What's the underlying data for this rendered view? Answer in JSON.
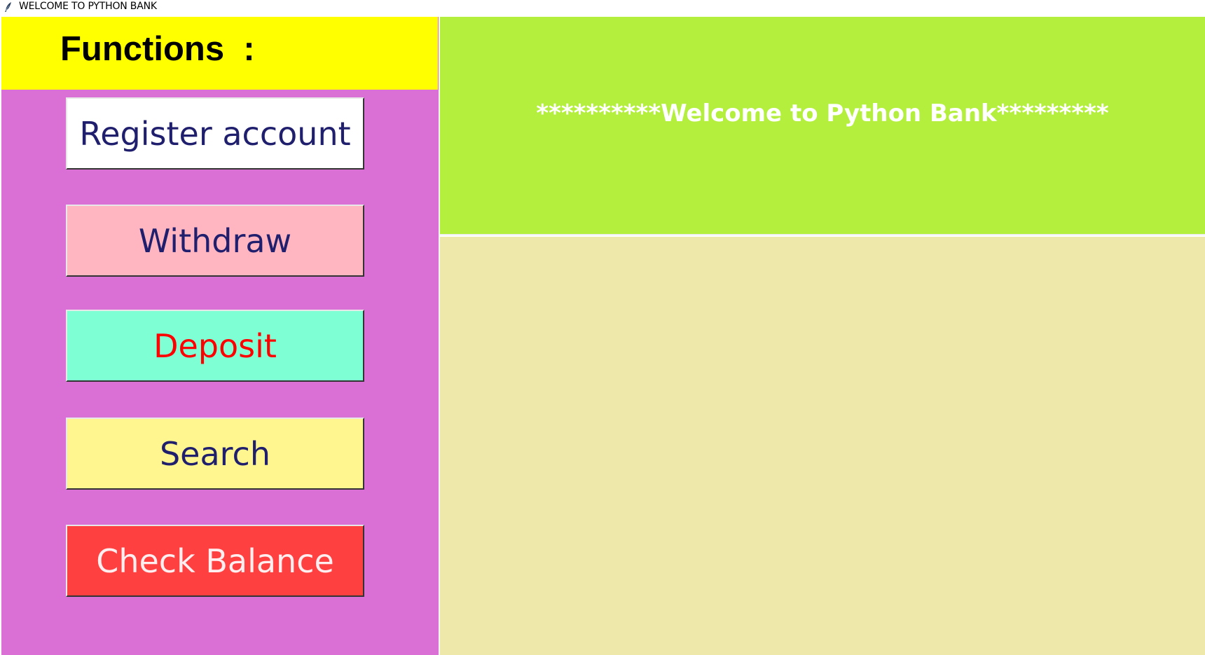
{
  "window": {
    "title": "WELCOME TO PYTHON BANK",
    "icon": "feather-icon"
  },
  "sidebar": {
    "header": "Functions  :",
    "header_color": "#ffff00",
    "background": "#da70d6",
    "buttons": [
      {
        "label": "Register account",
        "bg": "#ffffff",
        "fg": "#1f1f6e"
      },
      {
        "label": "Withdraw",
        "bg": "#ffb6c1",
        "fg": "#1f1f6e"
      },
      {
        "label": "Deposit",
        "bg": "#7fffd4",
        "fg": "#ff0000"
      },
      {
        "label": "Search",
        "bg": "#fff68f",
        "fg": "#1f1f6e"
      },
      {
        "label": "Check Balance",
        "bg": "#ff4040",
        "fg": "#ffeef0"
      }
    ]
  },
  "main": {
    "welcome_text": "**********Welcome to Python Bank*********",
    "welcome_bg": "#b3ef3c",
    "content_bg": "#eee8aa"
  }
}
